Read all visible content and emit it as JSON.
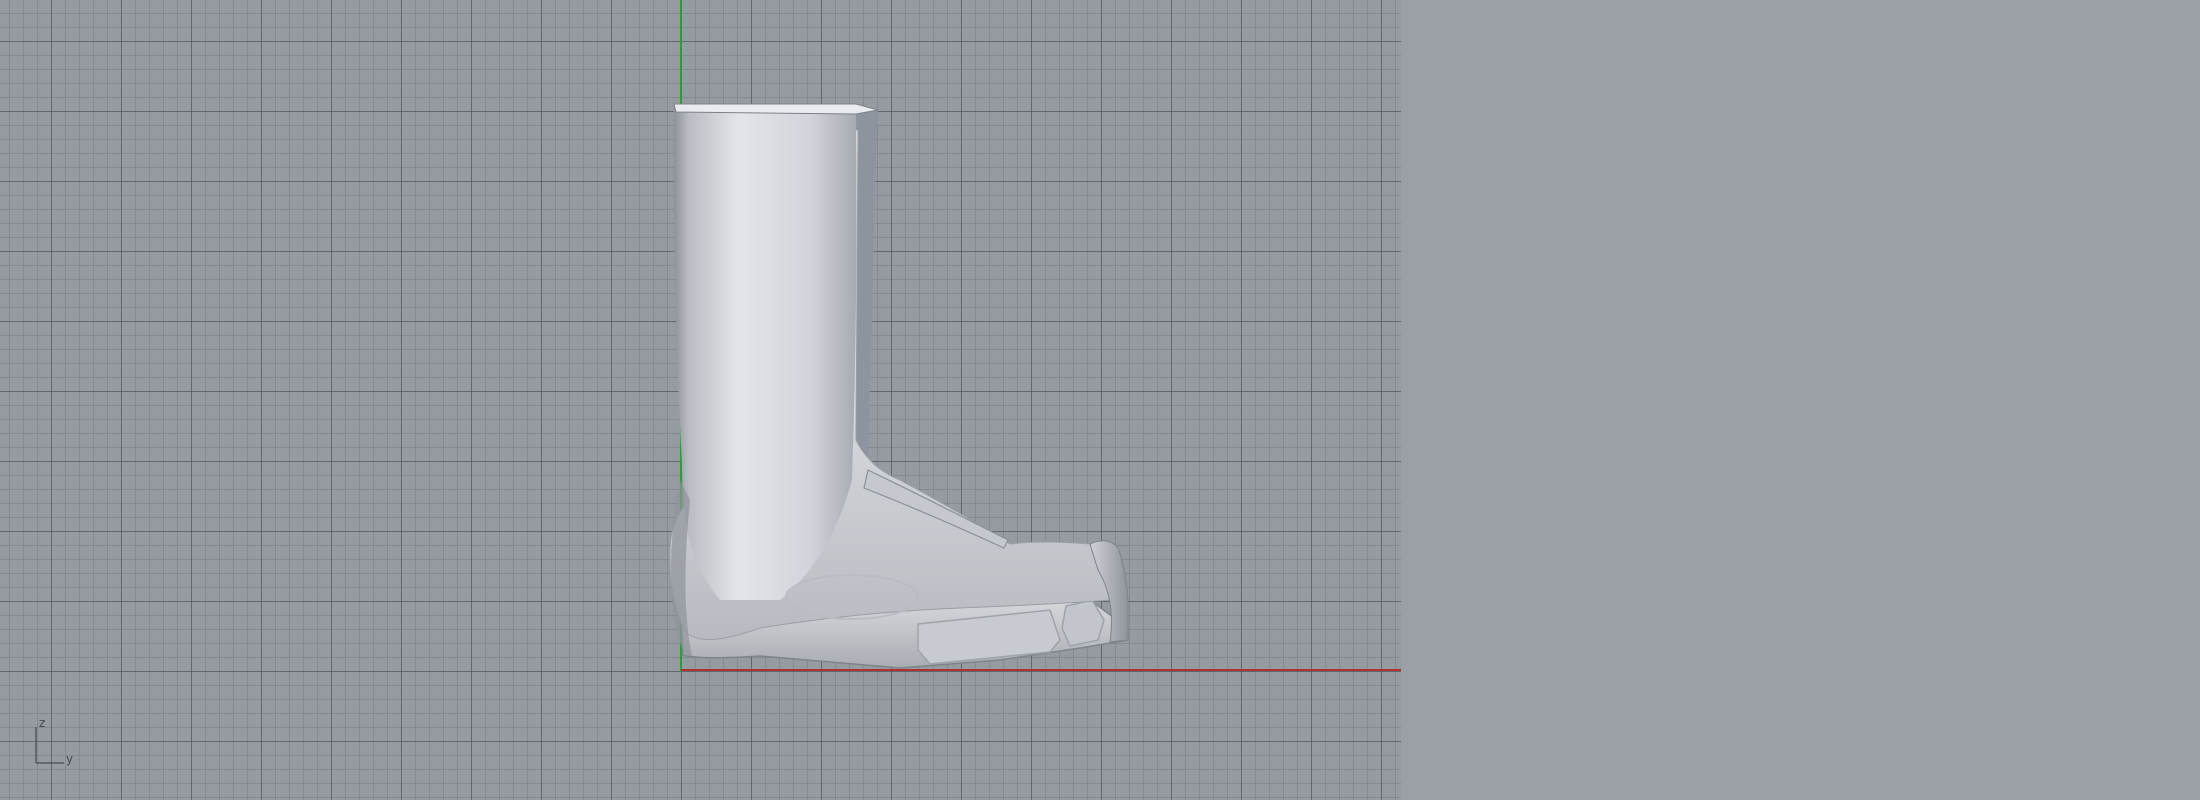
{
  "viewport": {
    "projection": "right",
    "world_axes": {
      "horizontal": "y-axis",
      "vertical": "z-axis",
      "x_axis_color": "#b23030",
      "y_axis_color": "#2f9a3b"
    },
    "model": {
      "name": "boot",
      "color": "#d3d6dc"
    },
    "axis_triad": {
      "vertical_label": "z",
      "horizontal_label": "y"
    }
  }
}
